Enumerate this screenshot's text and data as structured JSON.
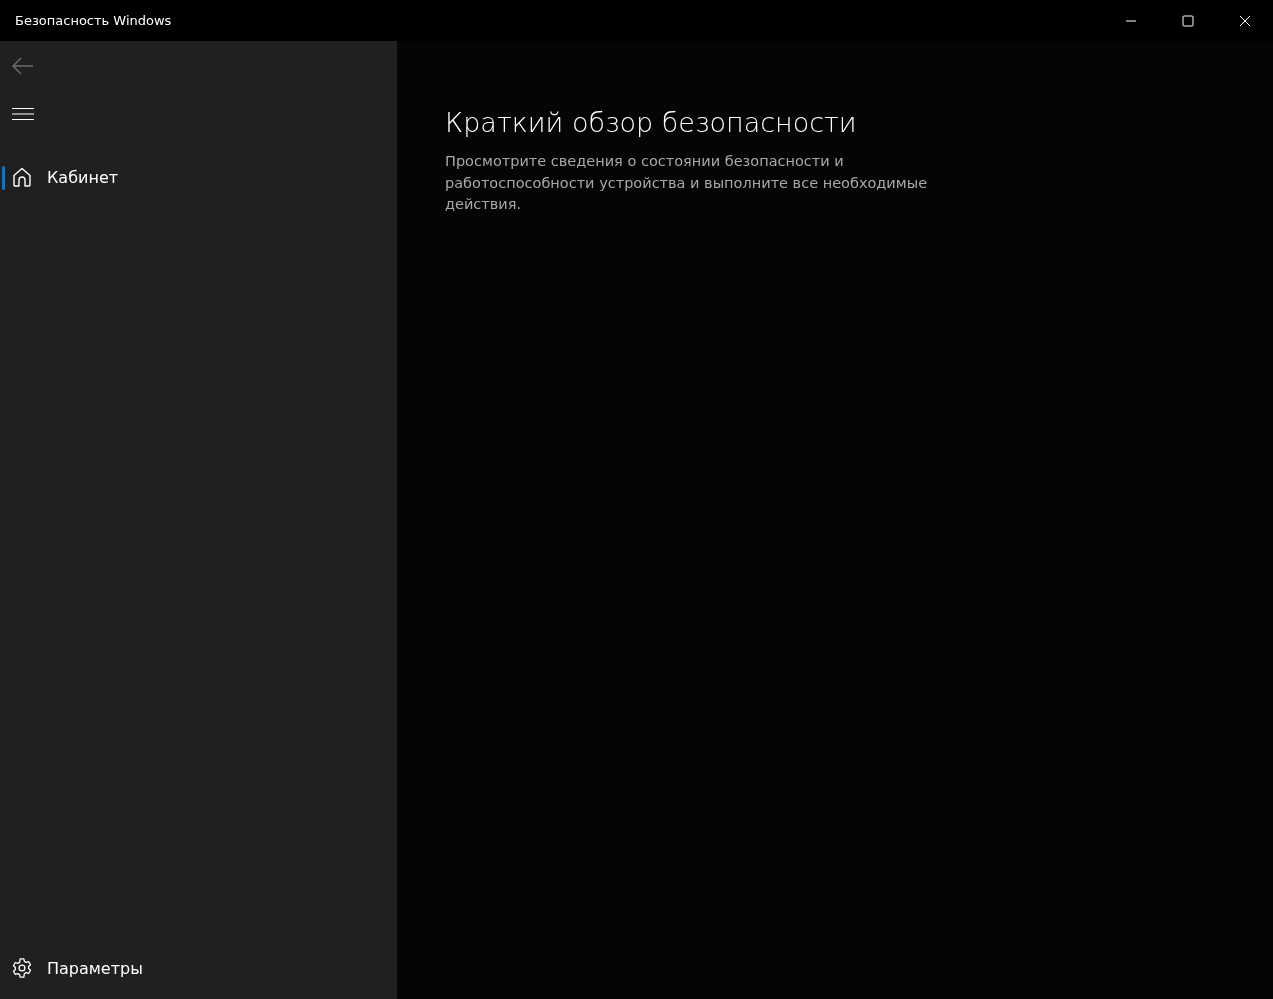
{
  "window": {
    "title": "Безопасность Windows"
  },
  "sidebar": {
    "back_disabled": true,
    "items": [
      {
        "label": "Кабинет",
        "kind": "home",
        "selected": true
      }
    ],
    "footer_item": {
      "label": "Параметры",
      "kind": "settings",
      "selected": false
    }
  },
  "content": {
    "heading": "Краткий обзор безопасности",
    "description": "Просмотрите сведения о состоянии безопасности и работоспособности устройства и выполните все необходимые действия."
  }
}
